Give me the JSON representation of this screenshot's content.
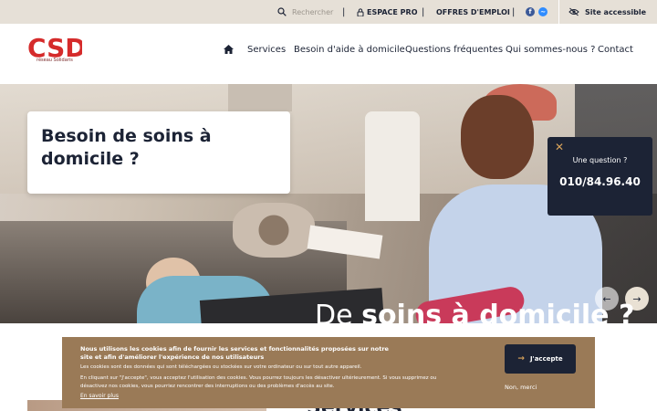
{
  "topbar": {
    "search_placeholder": "Rechercher",
    "separator": "|",
    "espace_pro": "ESPACE PRO",
    "offres_emploi": "OFFRES D'EMPLOI",
    "site_accessible": "Site accessible"
  },
  "brand": {
    "logo_text": "CSD",
    "tagline": "réseau Solidaris",
    "accent_color": "#d52b2b"
  },
  "nav": {
    "items": [
      "Services",
      "Besoin d'aide à domicile",
      "Questions fréquentes",
      "Qui sommes-nous ?",
      "Contact"
    ]
  },
  "hero": {
    "title": "Besoin de soins à domicile ?",
    "caption_light": "De ",
    "caption_bold": "soins à domicile ?",
    "prev_arrow": "←",
    "next_arrow": "→"
  },
  "question_box": {
    "close": "✕",
    "label": "Une question ?",
    "phone": "010/84.96.40"
  },
  "cookie_banner": {
    "headline": "Nous utilisons les cookies afin de fournir les services et fonctionnalités proposées sur notre site et afin d'améliorer l'expérience de nos utilisateurs",
    "text1": "Les cookies sont des données qui sont téléchargées ou stockées sur votre ordinateur ou sur tout autre appareil.",
    "text2": "En cliquant sur \"J'accepte\", vous acceptez l'utilisation des cookies. Vous pourrez toujours les désactiver ultérieurement. Si vous supprimez ou désactivez nos cookies, vous pourriez rencontrer des interruptions ou des problèmes d'accès au site.",
    "more_link": "En savoir plus",
    "accept": "J'accepte",
    "decline": "Non, merci"
  },
  "section": {
    "title": "Services"
  }
}
